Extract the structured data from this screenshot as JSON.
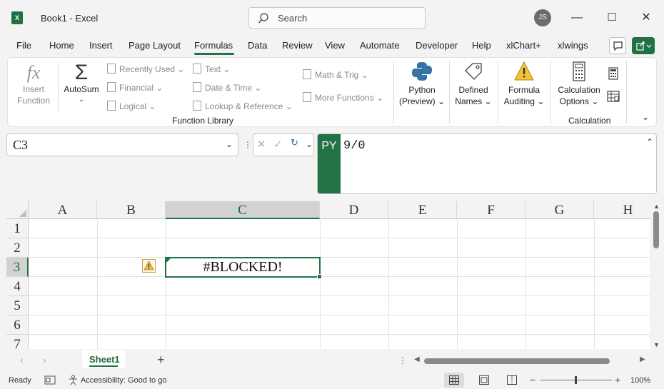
{
  "window": {
    "title": "Book1  -  Excel",
    "search_placeholder": "Search",
    "user_initials": "JS",
    "min": "—",
    "max": "☐",
    "close": "✕"
  },
  "menu": [
    "File",
    "Home",
    "Insert",
    "Page Layout",
    "Formulas",
    "Data",
    "Review",
    "View",
    "Automate",
    "Developer",
    "Help",
    "xlChart+",
    "xlwings"
  ],
  "menu_active": "Formulas",
  "ribbon": {
    "insert_function": [
      "Insert",
      "Function"
    ],
    "autosum": "AutoSum",
    "recently_used": "Recently Used",
    "financial": "Financial",
    "logical": "Logical",
    "text": "Text",
    "date_time": "Date & Time",
    "lookup_reference": "Lookup & Reference",
    "math_trig": "Math & Trig",
    "more_functions": "More Functions",
    "function_library_label": "Function Library",
    "python": [
      "Python",
      "(Preview)"
    ],
    "defined_names": [
      "Defined",
      "Names"
    ],
    "formula_auditing": [
      "Formula",
      "Auditing"
    ],
    "calculation_options": [
      "Calculation",
      "Options"
    ],
    "calculation_label": "Calculation"
  },
  "formula_bar": {
    "name_box": "C3",
    "badge": "PY",
    "formula": "9/0"
  },
  "grid": {
    "columns": [
      "A",
      "B",
      "C",
      "D",
      "E",
      "F",
      "G",
      "H"
    ],
    "rows": [
      "1",
      "2",
      "3",
      "4",
      "5",
      "6",
      "7"
    ],
    "selected_column": "C",
    "selected_row": "3",
    "active_cell_value": "#BLOCKED!"
  },
  "sheets": [
    "Sheet1"
  ],
  "status": {
    "ready": "Ready",
    "accessibility": "Accessibility: Good to go",
    "zoom": "100%"
  }
}
